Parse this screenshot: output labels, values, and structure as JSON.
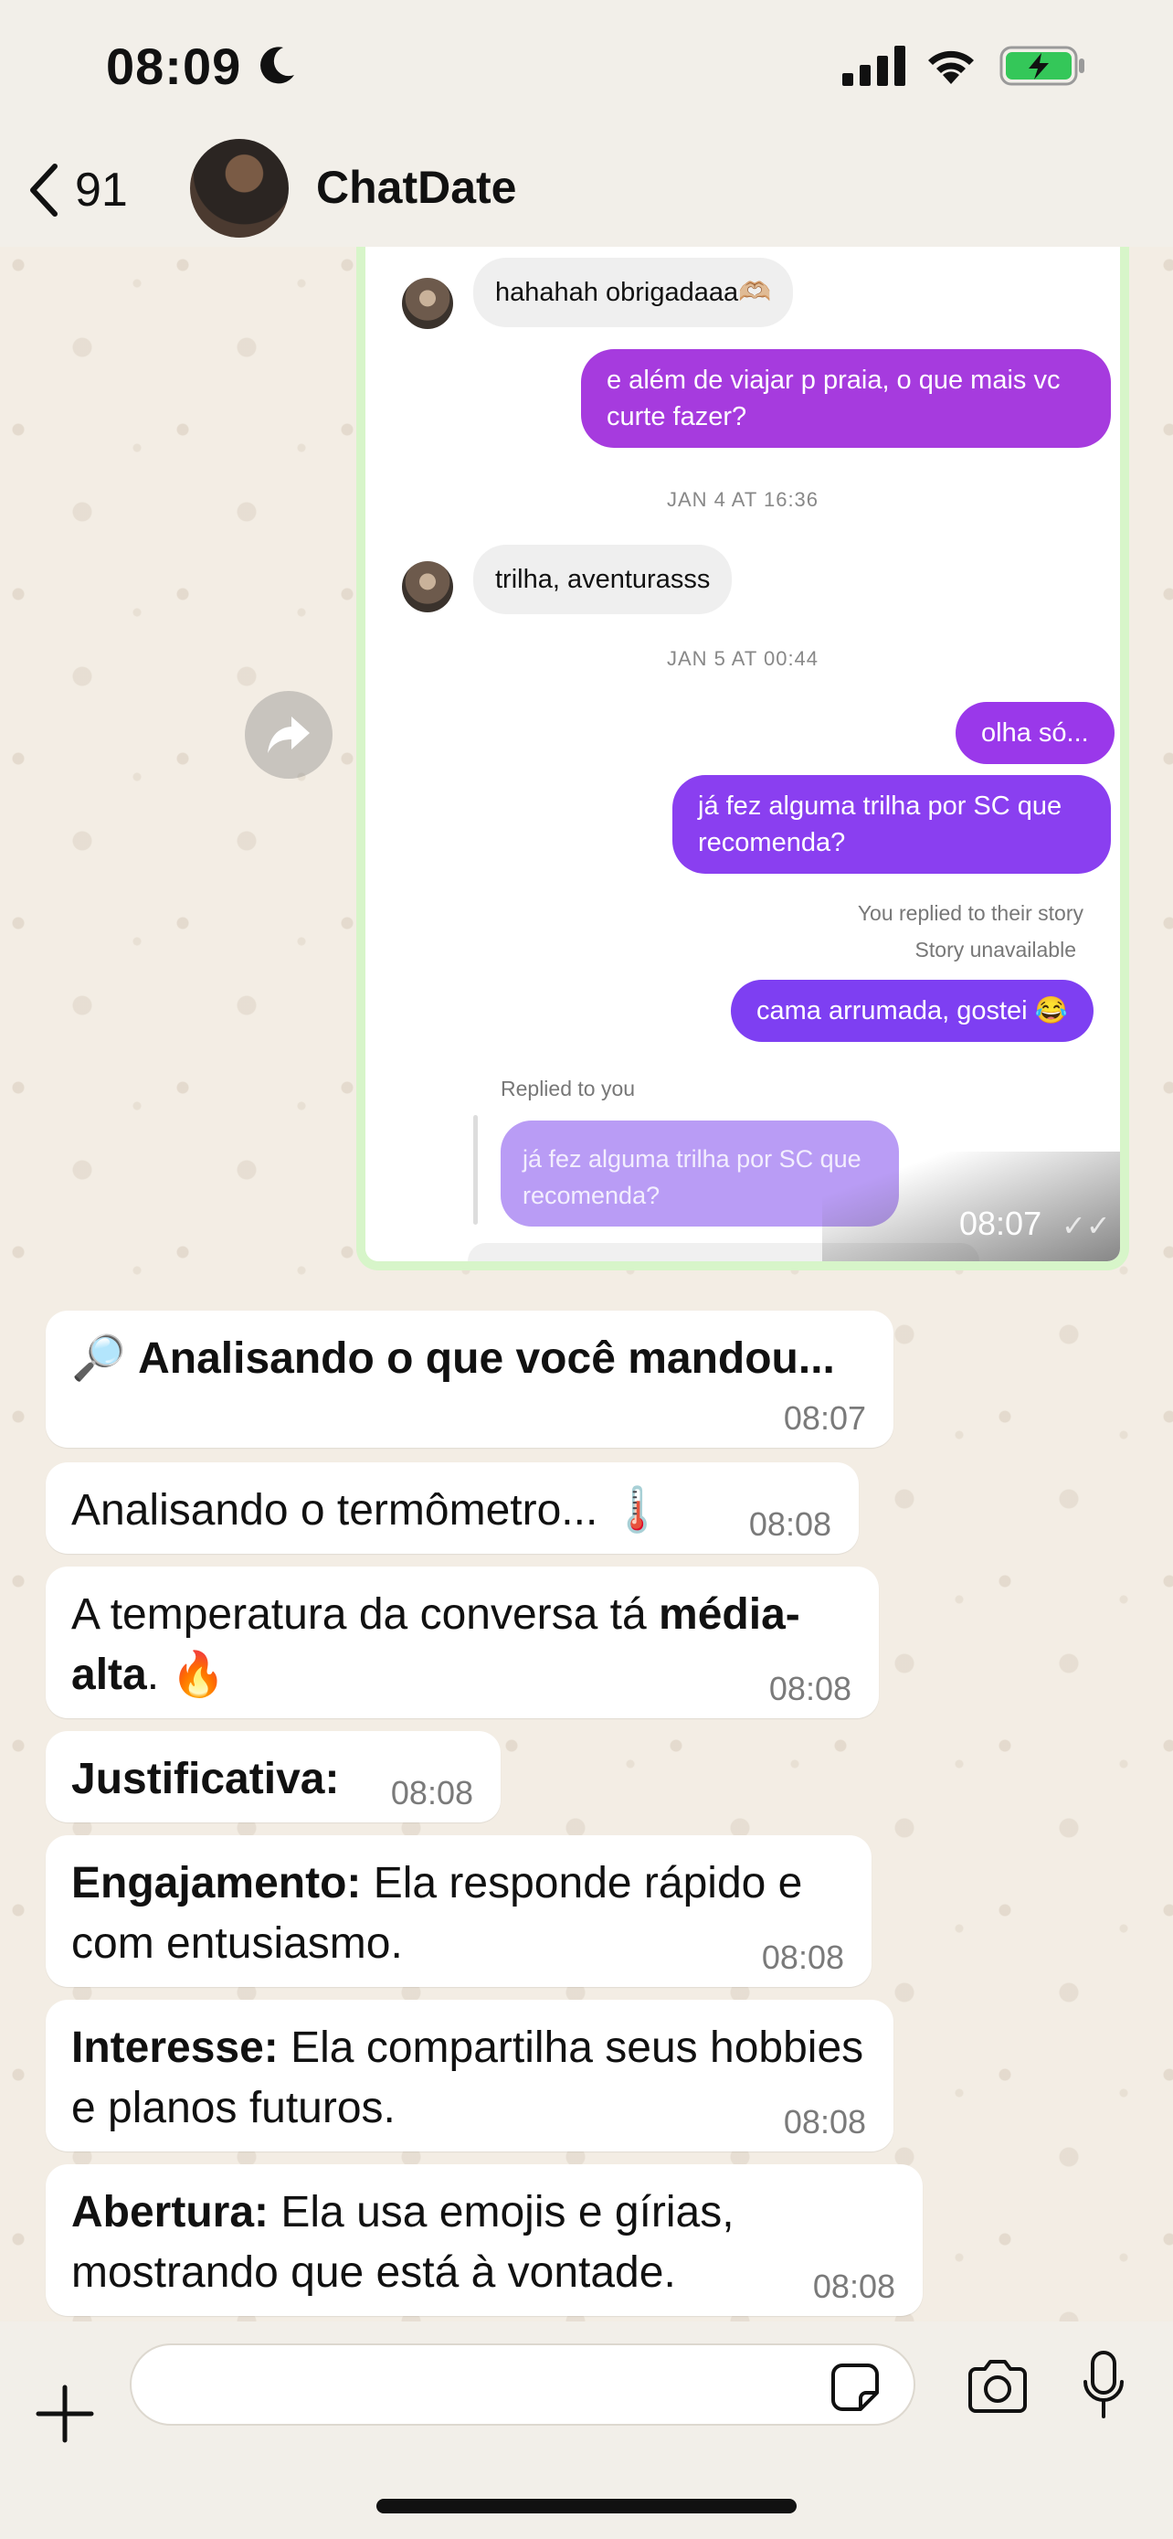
{
  "status_bar": {
    "time": "08:09"
  },
  "header": {
    "back_count": "91",
    "contact_name": "ChatDate"
  },
  "screenshot": {
    "messages": [
      {
        "text": "hahahah obrigadaaa🫶🏼"
      },
      {
        "text": "e além de viajar p praia, o que mais vc curte fazer?"
      },
      {
        "text": "JAN 4 AT 16:36"
      },
      {
        "text": "trilha, aventurasss"
      },
      {
        "text": "JAN 5 AT 00:44"
      },
      {
        "text": "olha só..."
      },
      {
        "text": "já fez alguma trilha por SC que recomenda?"
      },
      {
        "text": "You replied to their story"
      },
      {
        "text": "Story unavailable"
      },
      {
        "text": "cama arrumada, gostei 😂"
      },
      {
        "text": "Replied to you"
      },
      {
        "text": "já fez alguma trilha por SC que recomenda?"
      }
    ],
    "time": "08:07",
    "ticks": "✓✓"
  },
  "bot": {
    "analyzing_prefix": "🔎 ",
    "analyzing": "Analisando o que você mandou...",
    "analyzing_time": "08:07",
    "thermometer": "Analisando o termômetro... 🌡️",
    "thermometer_time": "08:08",
    "temp_prefix": "A temperatura da conversa tá ",
    "temp_bold": "média-alta",
    "temp_suffix": ". 🔥",
    "temp_time": "08:08",
    "just": "Justificativa:",
    "just_time": "08:08",
    "eng_label": "Engajamento:",
    "eng_text": " Ela responde rápido e com entusiasmo.",
    "eng_time": "08:08",
    "int_label": "Interesse:",
    "int_text": " Ela compartilha seus hobbies e planos futuros.",
    "int_time": "08:08",
    "abe_label": "Abertura:",
    "abe_text": " Ela usa emojis e gírias, mostrando que está à vontade.",
    "abe_time": "08:08"
  },
  "input": {
    "value": "",
    "placeholder": ""
  },
  "colors": {
    "accent_purple": "#8a3ff0",
    "accent_magenta": "#a63bde",
    "background": "#efe8de"
  },
  "icons": [
    "moon-icon",
    "signal-icon",
    "wifi-icon",
    "battery-icon",
    "chevron-left-icon",
    "forward-icon",
    "plus-icon",
    "sticker-icon",
    "camera-icon",
    "mic-icon"
  ]
}
